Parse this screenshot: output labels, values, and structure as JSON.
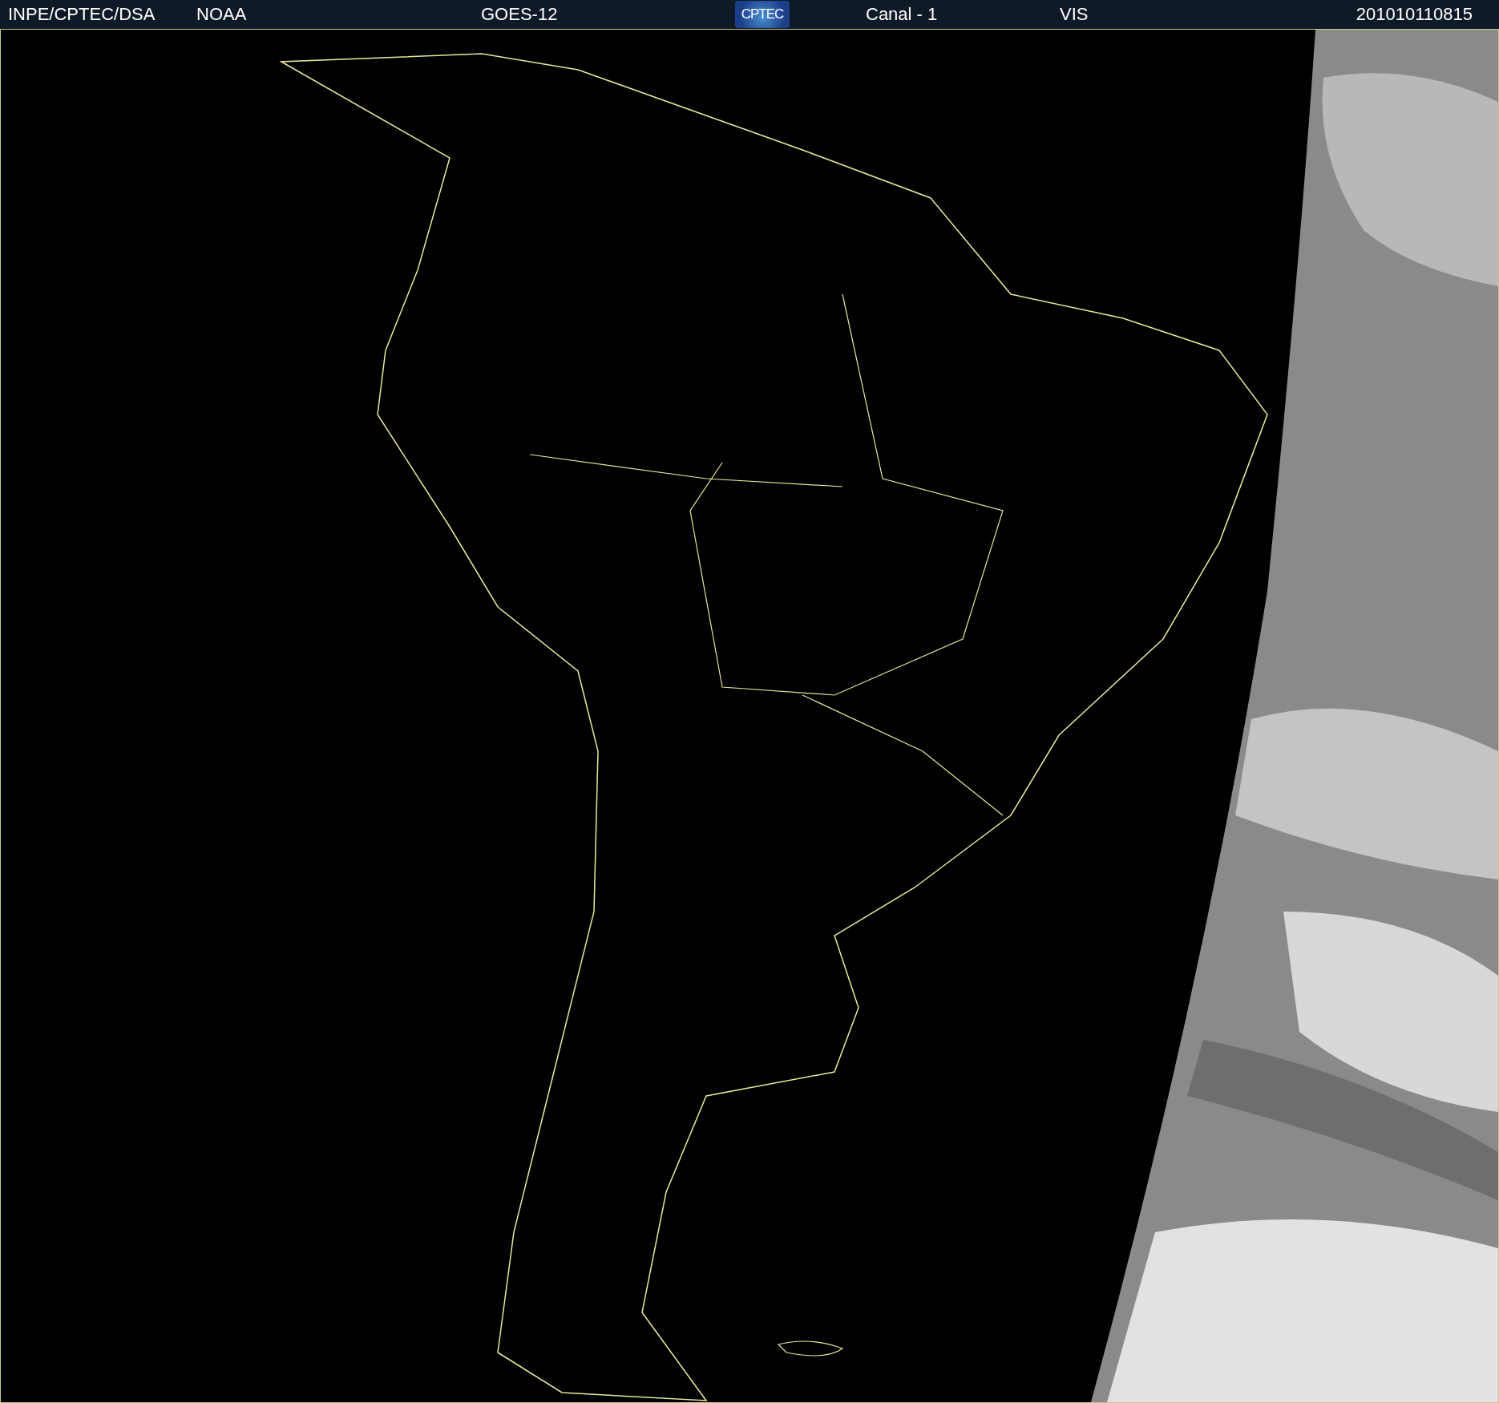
{
  "header": {
    "items": [
      {
        "kind": "text",
        "text": "INPE/CPTEC/DSA"
      },
      {
        "kind": "text",
        "text": "NOAA"
      },
      {
        "kind": "text",
        "text": "GOES-12"
      },
      {
        "kind": "logo",
        "text": "CPTEC"
      },
      {
        "kind": "text",
        "text": "Canal - 1"
      },
      {
        "kind": "text",
        "text": "VIS"
      },
      {
        "kind": "text",
        "text": "201010110815"
      }
    ]
  }
}
